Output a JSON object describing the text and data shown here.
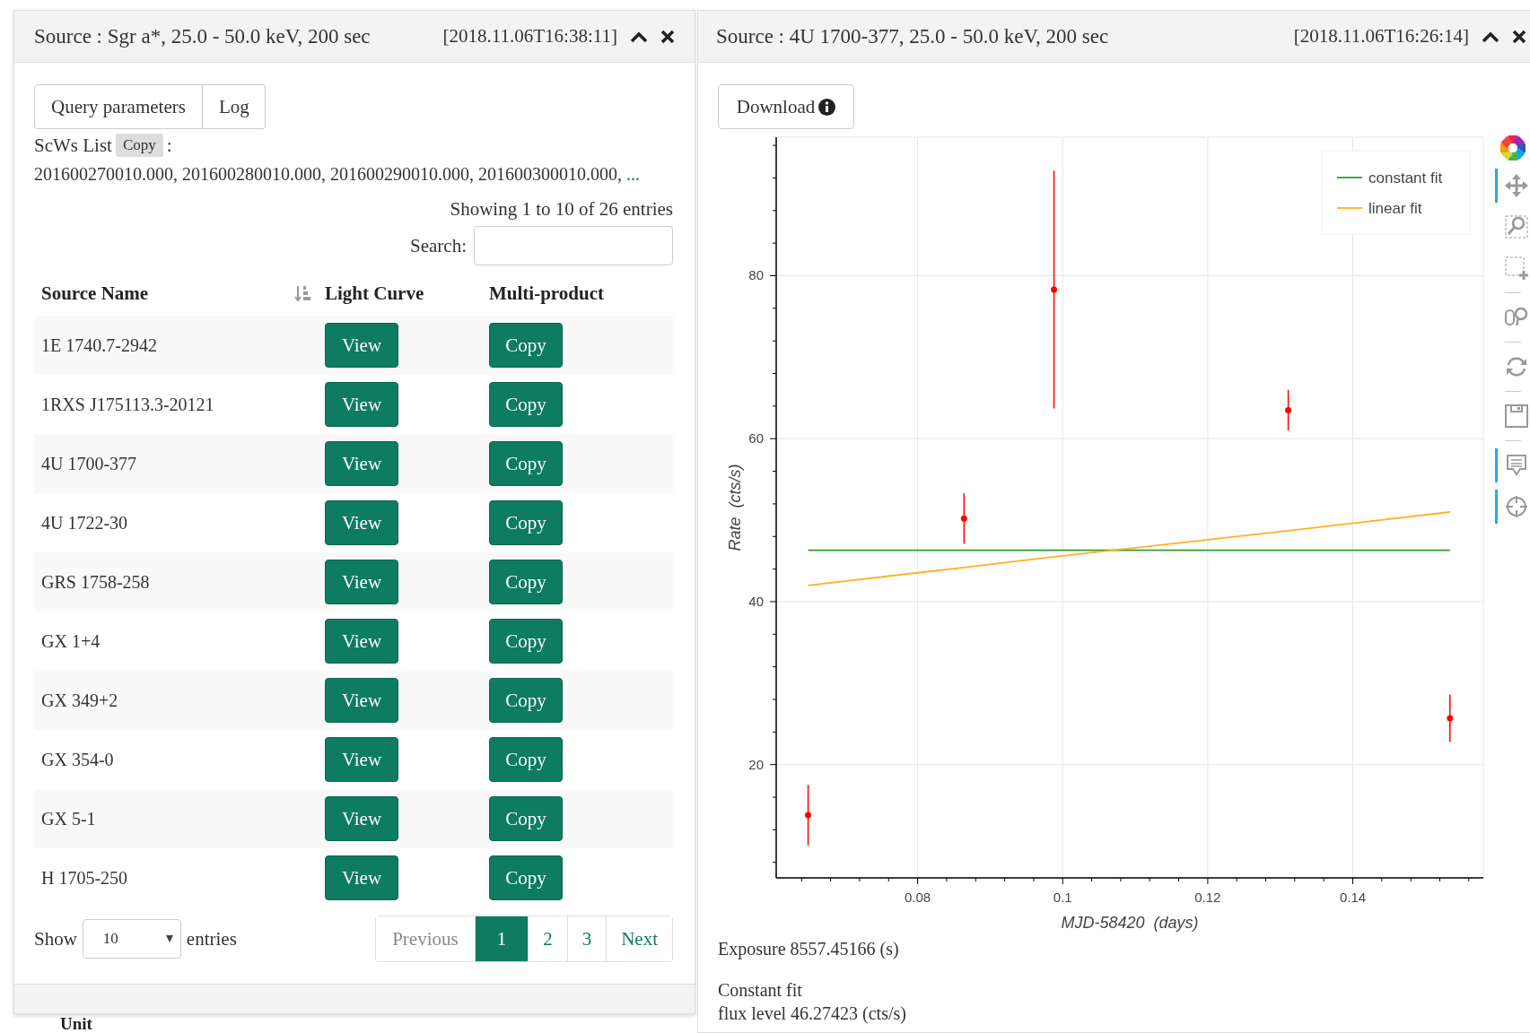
{
  "left_panel": {
    "title": "Source : Sgr a*, 25.0 - 50.0 keV, 200 sec",
    "timestamp": "[2018.11.06T16:38:11]",
    "tabs": [
      {
        "label": "Query parameters",
        "selected": false
      },
      {
        "label": "Log",
        "selected": false
      }
    ],
    "scws": {
      "label": "ScWs List",
      "copy_button": "Copy",
      "separator": ":",
      "values": "201600270010.000, 201600280010.000, 201600290010.000, 201600300010.000,",
      "more": "..."
    },
    "info": "Showing 1 to 10 of 26 entries",
    "search_label": "Search:",
    "table": {
      "columns": [
        "Source Name",
        "Light Curve",
        "Multi-product"
      ],
      "rows": [
        {
          "name": "1E 1740.7-2942",
          "view": "View",
          "copy": "Copy"
        },
        {
          "name": "1RXS J175113.3-20121",
          "view": "View",
          "copy": "Copy"
        },
        {
          "name": "4U 1700-377",
          "view": "View",
          "copy": "Copy"
        },
        {
          "name": "4U 1722-30",
          "view": "View",
          "copy": "Copy"
        },
        {
          "name": "GRS 1758-258",
          "view": "View",
          "copy": "Copy"
        },
        {
          "name": "GX 1+4",
          "view": "View",
          "copy": "Copy"
        },
        {
          "name": "GX 349+2",
          "view": "View",
          "copy": "Copy"
        },
        {
          "name": "GX 354-0",
          "view": "View",
          "copy": "Copy"
        },
        {
          "name": "GX 5-1",
          "view": "View",
          "copy": "Copy"
        },
        {
          "name": "H 1705-250",
          "view": "View",
          "copy": "Copy"
        }
      ]
    },
    "length": {
      "show_label": "Show",
      "value": "10",
      "entries_label": "entries"
    },
    "pagination": [
      {
        "label": "Previous",
        "disabled": true,
        "selected": false
      },
      {
        "label": "1",
        "disabled": false,
        "selected": true
      },
      {
        "label": "2",
        "disabled": false,
        "selected": false
      },
      {
        "label": "3",
        "disabled": false,
        "selected": false
      },
      {
        "label": "Next",
        "disabled": false,
        "selected": false
      }
    ]
  },
  "below_panel": {
    "label": "Unit"
  },
  "right_panel": {
    "title": "Source : 4U 1700-377, 25.0 - 50.0 keV, 200 sec",
    "timestamp": "[2018.11.06T16:26:14]",
    "download_button": "Download",
    "chart_data": {
      "type": "scatter",
      "xlabel": "MJD-58420  (days)",
      "ylabel": "Rate  (cts/s)",
      "x": [
        0.0649,
        0.0864,
        0.0988,
        0.1311,
        0.1534
      ],
      "series": [
        {
          "color": "#ff0000",
          "values": [
            13.8,
            50.2,
            78.3,
            63.5,
            25.7
          ],
          "errors": [
            3.7,
            3.1,
            14.6,
            2.5,
            2.9
          ]
        },
        {
          "type": "line",
          "name": "constant fit",
          "color": "#2ca02c",
          "values": [
            46.3,
            46.3,
            46.3,
            46.3,
            46.3
          ]
        },
        {
          "type": "line",
          "name": "linear fit",
          "color": "#ffb020",
          "values": [
            42.0,
            44.2,
            45.5,
            48.7,
            51.0
          ]
        }
      ],
      "grid": true,
      "legend": true,
      "xlim": [
        0.0605,
        0.158
      ],
      "ylim": [
        6.1,
        97
      ],
      "xticks": [
        0.08,
        0.1,
        0.12,
        0.14
      ],
      "yticks": [
        20,
        40,
        60,
        80
      ]
    },
    "toolbar": [
      {
        "kind": "pan",
        "active": true
      },
      {
        "kind": "box_zoom",
        "active": false
      },
      {
        "kind": "box_select",
        "active": false
      },
      {
        "kind": "wheel_zoom",
        "active": false
      },
      {
        "kind": "reset",
        "active": false
      },
      {
        "kind": "save",
        "active": false
      },
      {
        "kind": "hover",
        "active": true
      },
      {
        "kind": "crosshair",
        "active": true
      }
    ],
    "exposure": "Exposure 8557.45166 (s)",
    "fit_summary": [
      "Constant fit",
      "flux level 46.27423 (cts/s)"
    ]
  }
}
